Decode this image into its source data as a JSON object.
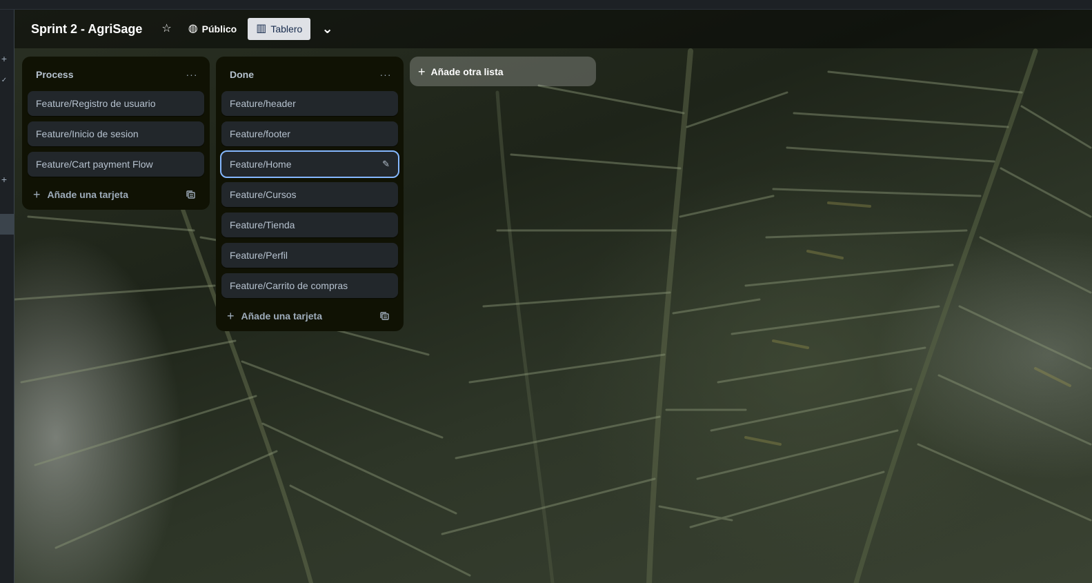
{
  "board": {
    "title": "Sprint 2 - AgriSage",
    "visibility_label": "Público",
    "view_label": "Tablero"
  },
  "icons": {
    "star": "☆",
    "globe": "◍",
    "board_view": "▥",
    "chevron_down": "⌄",
    "more": "···",
    "plus": "+",
    "pencil": "✎",
    "template": "template-icon"
  },
  "lists": [
    {
      "title": "Process",
      "cards": [
        "Feature/Registro de usuario",
        "Feature/Inicio de sesion",
        "Feature/Cart payment Flow"
      ],
      "add_card_label": "Añade una tarjeta"
    },
    {
      "title": "Done",
      "cards": [
        "Feature/header",
        "Feature/footer",
        "Feature/Home",
        "Feature/Cursos",
        "Feature/Tienda",
        "Feature/Perfil",
        "Feature/Carrito de compras"
      ],
      "add_card_label": "Añade una tarjeta"
    }
  ],
  "add_list_label": "Añade otra lista",
  "colors": {
    "list_bg": "#101204",
    "card_bg": "#22272b",
    "focus_ring": "#85b8ff",
    "view_button_bg": "#dfe1e6"
  }
}
